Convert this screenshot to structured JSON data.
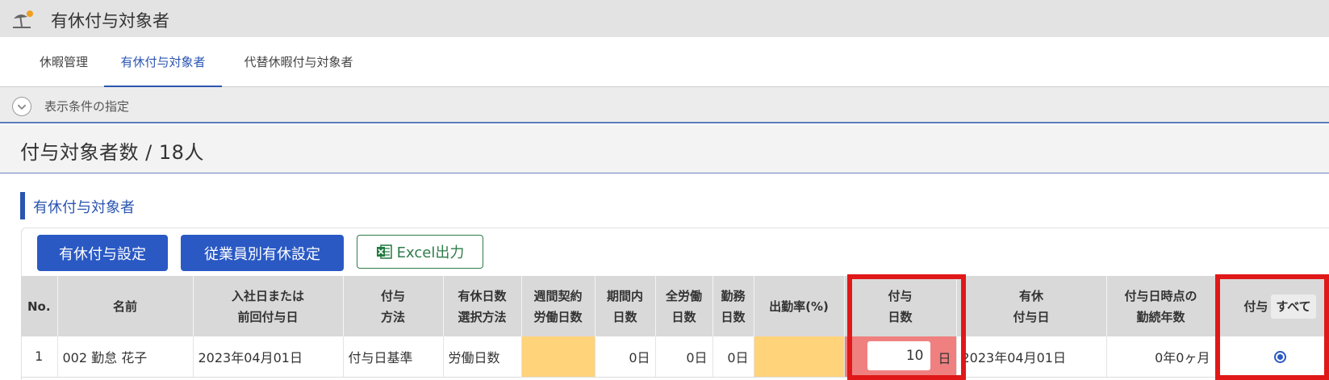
{
  "app": {
    "title": "有休付与対象者",
    "icon": "beach-umbrella-icon"
  },
  "tabs": [
    {
      "label": "休暇管理",
      "active": false
    },
    {
      "label": "有休付与対象者",
      "active": true
    },
    {
      "label": "代替休暇付与対象者",
      "active": false
    }
  ],
  "filter": {
    "label": "表示条件の指定",
    "icon": "chevron-down-icon"
  },
  "count": {
    "text": "付与対象者数 / 18人"
  },
  "section": {
    "title": "有休付与対象者"
  },
  "buttons": {
    "grant_settings": "有休付与設定",
    "per_employee_settings": "従業員別有休設定",
    "excel_export": "Excel出力"
  },
  "table": {
    "headers": {
      "no": "No.",
      "name": "名前",
      "hire_date_1": "入社日または",
      "hire_date_2": "前回付与日",
      "method_1": "付与",
      "method_2": "方法",
      "days_sel_1": "有休日数",
      "days_sel_2": "選択方法",
      "weekly_1": "週間契約",
      "weekly_2": "労働日数",
      "period_1": "期間内",
      "period_2": "日数",
      "full_1": "全労働",
      "full_2": "日数",
      "work_1": "勤務",
      "work_2": "日数",
      "attendance": "出勤率(%)",
      "grant_days_1": "付与",
      "grant_days_2": "日数",
      "grant_date_1": "有休",
      "grant_date_2": "付与日",
      "tenure_1": "付与日時点の",
      "tenure_2": "勤続年数",
      "grant": "付与",
      "select_all": "すべて"
    },
    "rows": [
      {
        "no": "1",
        "name": "002 勤怠 花子",
        "hire_date": "2023年04月01日",
        "method": "付与日基準",
        "days_selection": "労働日数",
        "weekly_days": "",
        "period_days": "0日",
        "full_work_days": "0日",
        "work_days": "0日",
        "attendance_rate": "",
        "grant_days": "10",
        "grant_days_unit": "日",
        "grant_date": "2023年04月01日",
        "tenure": "0年0ヶ月",
        "grant_selected": true
      }
    ]
  },
  "colors": {
    "accent": "#2a55b0",
    "button": "#2a59c4",
    "highlight": "#e01818",
    "warning_cell": "#ffd37a",
    "grant_cell": "#f08080"
  }
}
